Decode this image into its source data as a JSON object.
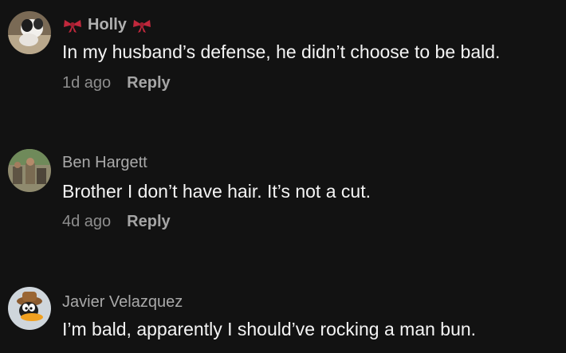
{
  "comments": [
    {
      "username": "Holly",
      "decoration_icon": "bow-icon",
      "decoration_color": "#c0283c",
      "text": "In my husband’s defense, he didn’t choose to be bald.",
      "time": "1d ago",
      "reply_label": "Reply"
    },
    {
      "username": "Ben Hargett",
      "text": "Brother I don’t have hair. It’s not a cut.",
      "time": "4d ago",
      "reply_label": "Reply"
    },
    {
      "username": "Javier Velazquez",
      "text": "I’m bald, apparently I should’ve rocking a man bun."
    }
  ]
}
